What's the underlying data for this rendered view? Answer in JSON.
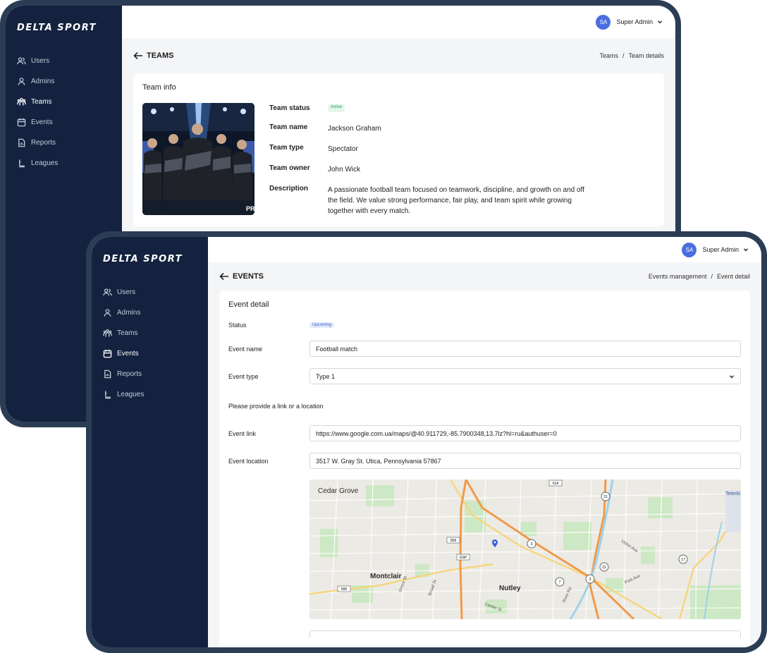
{
  "brand": {
    "logo_text": "DELTA SPORT"
  },
  "nav": {
    "items": [
      {
        "label": "Users",
        "icon": "users-icon"
      },
      {
        "label": "Admins",
        "icon": "user-icon"
      },
      {
        "label": "Teams",
        "icon": "team-icon"
      },
      {
        "label": "Events",
        "icon": "calendar-icon"
      },
      {
        "label": "Reports",
        "icon": "report-icon"
      },
      {
        "label": "Leagues",
        "icon": "league-icon"
      }
    ]
  },
  "user": {
    "initials": "SA",
    "name": "Super Admin"
  },
  "teams_screen": {
    "active_nav": "Teams",
    "back_label": "TEAMS",
    "breadcrumb": [
      "Teams",
      "Team details"
    ],
    "card_title": "Team info",
    "fields": {
      "status_label": "Team status",
      "status_value": "Active",
      "name_label": "Team name",
      "name_value": "Jackson Graham",
      "type_label": "Team type",
      "type_value": "Spectator",
      "owner_label": "Team owner",
      "owner_value": "John Wick",
      "description_label": "Description",
      "description_value": "A passionate football team focused on teamwork, discipline, and growth on and off the field. We value strong performance, fair play, and team spirit while growing together with every match."
    }
  },
  "events_screen": {
    "active_nav": "Events",
    "back_label": "EVENTS",
    "breadcrumb": [
      "Events management",
      "Event detail"
    ],
    "card_title": "Event detail",
    "status_label": "Status",
    "status_value": "Upcoming",
    "event_name_label": "Event name",
    "event_name_value": "Football match",
    "event_type_label": "Event type",
    "event_type_value": "Type 1",
    "hint": "Please provide a link or a location",
    "event_link_label": "Event link",
    "event_link_value": "https://www.google.com.ua/maps/@40.911729,-85.7900348,13.7lz?hl=ru&authuser=0",
    "event_location_label": "Event location",
    "event_location_value": "3517 W. Gray St. Utica, Pennsylvania 57867",
    "map": {
      "places": [
        "Cedar Grove",
        "Montclair",
        "Nutley"
      ],
      "streets": [
        "Grove St",
        "Broad St",
        "Centre St",
        "River Rd",
        "Park Ave",
        "Union Ave"
      ],
      "route_badges": [
        "509",
        "GSP",
        "506",
        "614",
        "3",
        "21",
        "7",
        "17"
      ],
      "corner_label": "Teterbi"
    }
  },
  "colors": {
    "sidebar": "#14223f",
    "frame": "#2b3d54",
    "accent": "#4a6ee0",
    "active_badge": "#21a366",
    "upcoming_badge": "#4060c9"
  }
}
